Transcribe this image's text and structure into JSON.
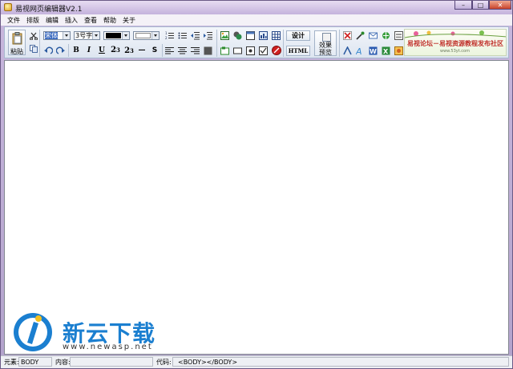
{
  "window": {
    "title": "易视网页编辑器V2.1",
    "min_glyph": "–",
    "max_glyph": "□",
    "close_glyph": "✕"
  },
  "menu": [
    "文件",
    "排版",
    "编辑",
    "插入",
    "查看",
    "帮助",
    "关于"
  ],
  "toolbar": {
    "paste_label": "粘贴",
    "font_select": "宋体",
    "size_select": "3号字",
    "bold": "B",
    "italic": "I",
    "underline": "U",
    "superscript": "2",
    "superscript_exp": "3",
    "subscript": "2",
    "subscript_sub": "3",
    "hr": "—",
    "strike": "S",
    "design_label": "设计",
    "html_label": "HTML",
    "preview_label_1": "效果",
    "preview_label_2": "预览"
  },
  "banner": {
    "text": "易视论坛－易视资源教程发布社区",
    "url": "www.53yt.com"
  },
  "colors": {
    "fore_color": "#000000",
    "back_color": "#ffffff"
  },
  "status": {
    "element_label": "元素:",
    "element_value": "BODY",
    "content_label": "内容:",
    "code_label": "代码:",
    "code_value": "<BODY></BODY>"
  },
  "watermark": {
    "text": "新云下载",
    "url": "www.newasp.net"
  }
}
